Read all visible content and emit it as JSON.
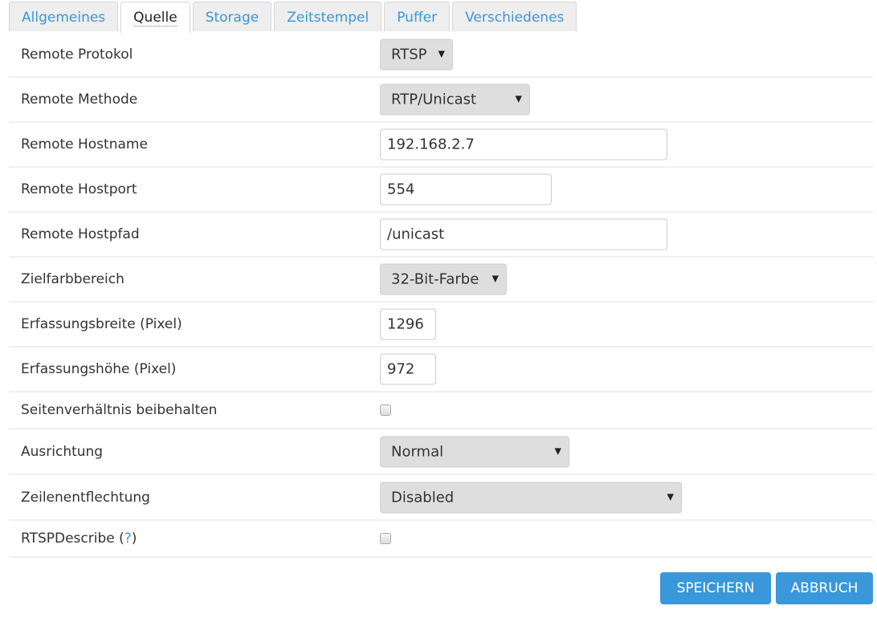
{
  "tabs": [
    {
      "label": "Allgemeines",
      "active": false
    },
    {
      "label": "Quelle",
      "active": true
    },
    {
      "label": "Storage",
      "active": false
    },
    {
      "label": "Zeitstempel",
      "active": false
    },
    {
      "label": "Puffer",
      "active": false
    },
    {
      "label": "Verschiedenes",
      "active": false
    }
  ],
  "fields": {
    "remote_protokol": {
      "label": "Remote Protokol",
      "value": "RTSP"
    },
    "remote_methode": {
      "label": "Remote Methode",
      "value": "RTP/Unicast"
    },
    "remote_hostname": {
      "label": "Remote Hostname",
      "value": "192.168.2.7"
    },
    "remote_hostport": {
      "label": "Remote Hostport",
      "value": "554"
    },
    "remote_hostpfad": {
      "label": "Remote Hostpfad",
      "value": "/unicast"
    },
    "zielfarbbereich": {
      "label": "Zielfarbbereich",
      "value": "32-Bit-Farbe"
    },
    "erfassungsbreite": {
      "label": "Erfassungsbreite (Pixel)",
      "value": "1296"
    },
    "erfassungshoehe": {
      "label": "Erfassungshöhe (Pixel)",
      "value": "972"
    },
    "seitenverhaeltnis": {
      "label": "Seitenverhältnis beibehalten",
      "checked": false
    },
    "ausrichtung": {
      "label": "Ausrichtung",
      "value": "Normal"
    },
    "zeilenentflechtung": {
      "label": "Zeilenentflechtung",
      "value": "Disabled"
    },
    "rtspdescribe": {
      "label": "RTSPDescribe",
      "help_open": " (",
      "help_mark": "?",
      "help_close": ")",
      "checked": false
    }
  },
  "buttons": {
    "save": "SPEICHERN",
    "cancel": "ABBRUCH"
  },
  "colors": {
    "accent": "#3a97d9"
  }
}
